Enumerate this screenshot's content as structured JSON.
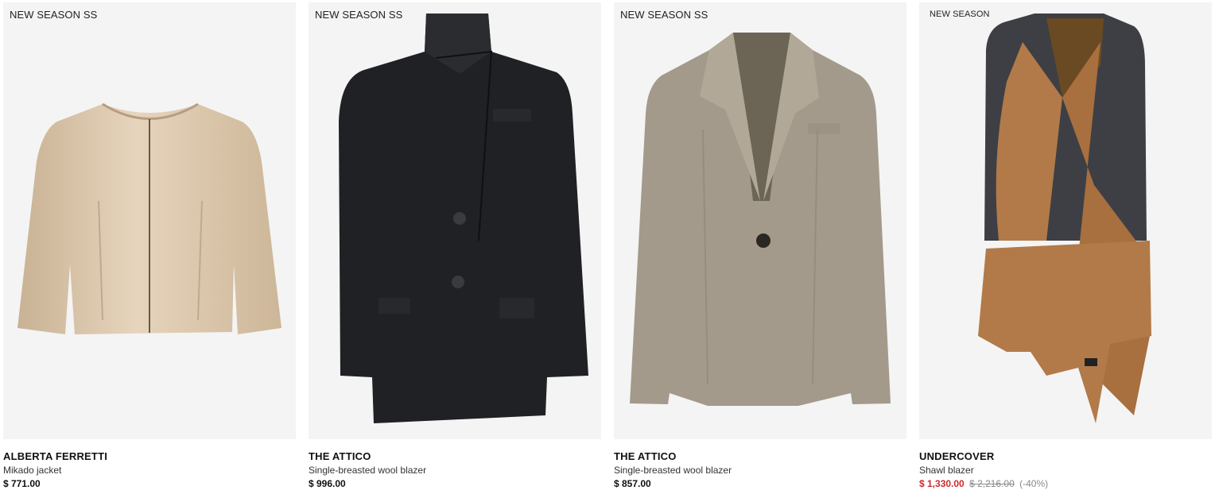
{
  "products": [
    {
      "badge": "NEW SEASON SS",
      "brand": "ALBERTA FERRETTI",
      "name": "Mikado jacket",
      "price": "$ 771.00",
      "garment_color": "#d9c3a6",
      "image_icon": "mikado-jacket-image"
    },
    {
      "badge": "NEW SEASON SS",
      "brand": "THE ATTICO",
      "name": "Single-breasted wool blazer",
      "price": "$ 996.00",
      "garment_color": "#1e2023",
      "image_icon": "black-blazer-image"
    },
    {
      "badge": "NEW SEASON SS",
      "brand": "THE ATTICO",
      "name": "Single-breasted wool blazer",
      "price": "$ 857.00",
      "garment_color": "#a39a8b",
      "image_icon": "taupe-blazer-image"
    },
    {
      "badge": "NEW SEASON",
      "brand": "UNDERCOVER",
      "name": "Shawl blazer",
      "sale_price": "$ 1,330.00",
      "original_price": "$ 2,216.00",
      "discount": "(-40%)",
      "garment_color": "#b27a49",
      "image_icon": "shawl-blazer-image"
    }
  ],
  "colors": {
    "sale": "#d0282b",
    "image_background": "#f4f4f4"
  }
}
